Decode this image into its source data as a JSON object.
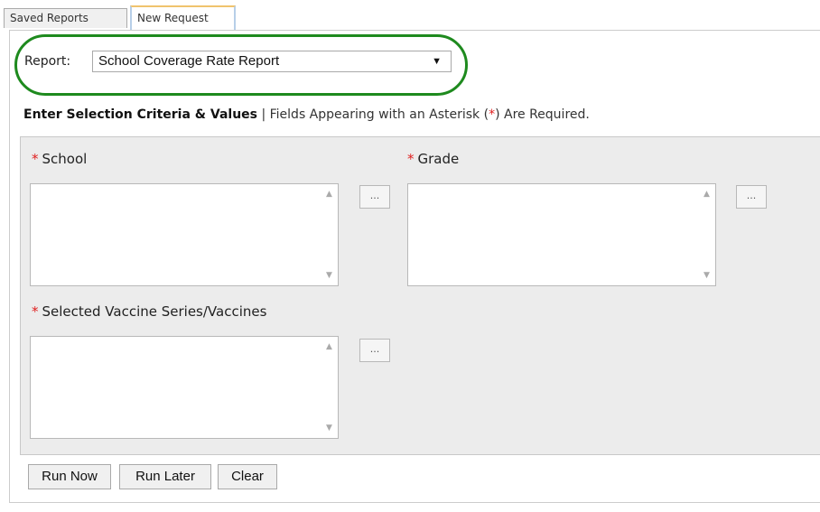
{
  "tabs": {
    "saved_reports": "Saved Reports",
    "new_request": "New Request"
  },
  "report": {
    "label": "Report:",
    "selected": "School Coverage Rate Report",
    "arrow": "▼"
  },
  "criteria": {
    "title": "Enter Selection Criteria & Values",
    "separator": " | ",
    "note_prefix": "Fields Appearing with an Asterisk (",
    "asterisk": "*",
    "note_suffix": ") Are Required."
  },
  "fields": {
    "required_marker": "*",
    "school": "School",
    "grade": "Grade",
    "vaccine": "Selected Vaccine Series/Vaccines",
    "ellipsis": "..."
  },
  "buttons": {
    "run_now": "Run Now",
    "run_later": "Run Later",
    "clear": "Clear"
  },
  "colors": {
    "required": "#e02020",
    "highlight_oval": "#1e8a1e",
    "active_tab_top": "#f0c36d"
  }
}
